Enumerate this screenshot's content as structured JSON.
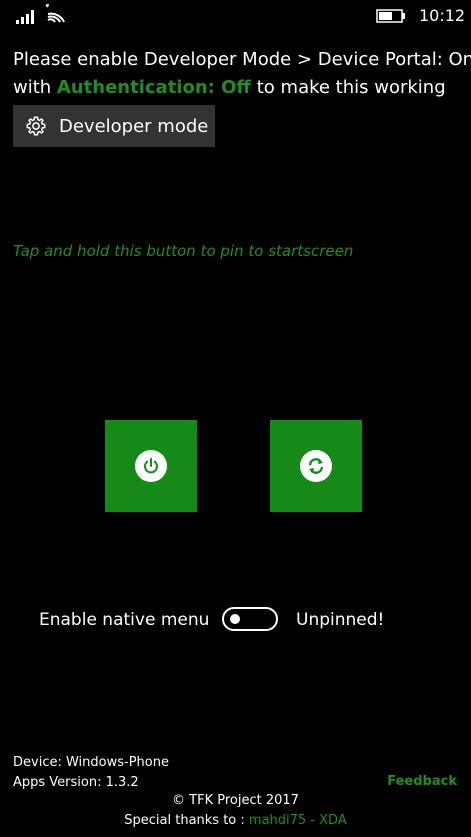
{
  "status_bar": {
    "time": "10:12",
    "icons": [
      "signal-icon",
      "wifi-icon",
      "battery-icon"
    ]
  },
  "instructions": {
    "line1": "Please enable Developer Mode > Device Portal: On",
    "line2_prefix": "with ",
    "auth_text": "Authentication: Off",
    "line2_suffix": " to make this working"
  },
  "developer_button": {
    "icon": "gear-icon",
    "label": "Developer mode"
  },
  "hint": "Tap and hold this button to pin to startscreen",
  "tiles": [
    {
      "icon": "power-icon"
    },
    {
      "icon": "refresh-icon"
    }
  ],
  "native_menu": {
    "label": "Enable native menu",
    "toggle_on": false,
    "pin_status": "Unpinned!"
  },
  "device_info": {
    "device": "Device: Windows-Phone",
    "version": "Apps Version: 1.3.2"
  },
  "feedback_label": "Feedback",
  "copyright": "© TFK Project 2017",
  "thanks": {
    "prefix": "Special thanks to : ",
    "credit": "mahdi75 - XDA"
  },
  "colors": {
    "accent": "#1f8e23",
    "tile": "#168a19",
    "button_bg": "#333333",
    "background": "#000000"
  }
}
